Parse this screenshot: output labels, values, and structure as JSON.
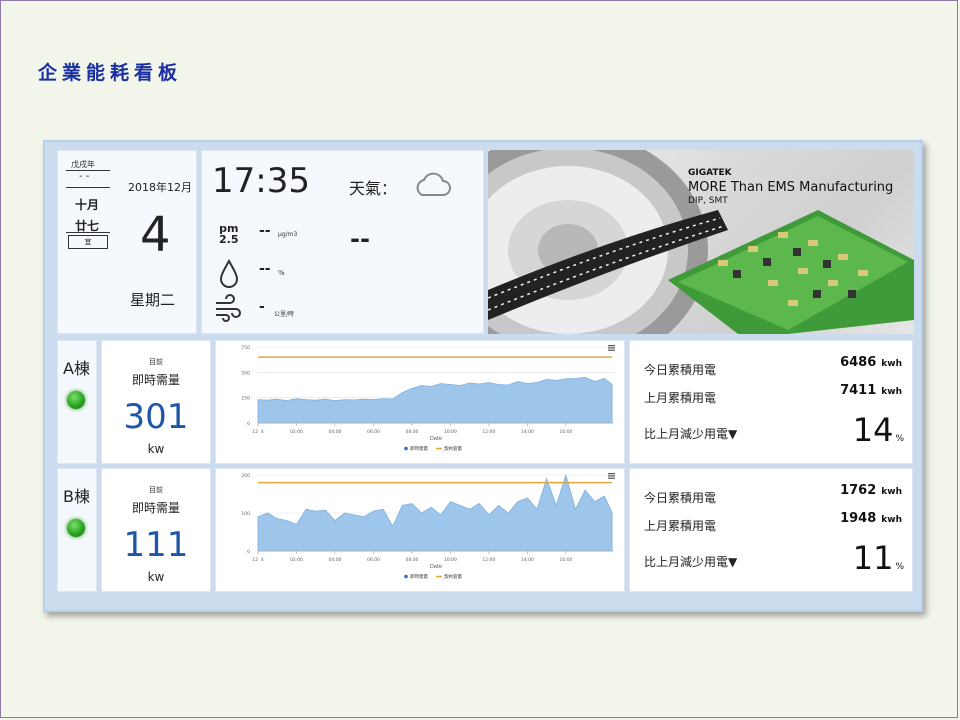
{
  "page": {
    "title": "企業能耗看板"
  },
  "calendar": {
    "ganzhi_year": "戊戌年",
    "dash": "- -",
    "lunar_month": "十月",
    "lunar_day": "廿七",
    "yi": "宜",
    "year_month": "2018年12月",
    "day": "4",
    "weekday": "星期二"
  },
  "weather": {
    "time": "17:35",
    "label": "天氣：",
    "value": "--",
    "icon": "cloud-icon",
    "pm_label_top": "pm",
    "pm_label_bottom": "2.5",
    "pm_value": "--",
    "pm_unit": "μg/m3",
    "humidity_icon": "droplet-icon",
    "humidity_value": "--",
    "humidity_unit": "%",
    "wind_icon": "wind-icon",
    "wind_value": "-",
    "wind_unit": "公里/時"
  },
  "banner": {
    "brand": "GIGATEK",
    "line1": "MORE Than EMS Manufacturing",
    "line2": "DIP, SMT"
  },
  "buildings": [
    {
      "name": "A棟",
      "status_color": "#2aa320",
      "demand_label_small": "目前",
      "demand_label": "即時需量",
      "demand_value": "301",
      "demand_unit": "kw",
      "today_label": "今日累積用電",
      "today_value": "6486",
      "lastmonth_label": "上月累積用電",
      "lastmonth_value": "7411",
      "energy_unit": "kwh",
      "compare_label": "比上月減少用電▼",
      "compare_value": "14",
      "compare_unit": "%"
    },
    {
      "name": "B棟",
      "status_color": "#2aa320",
      "demand_label_small": "目前",
      "demand_label": "即時需量",
      "demand_value": "111",
      "demand_unit": "kw",
      "today_label": "今日累積用電",
      "today_value": "1762",
      "lastmonth_label": "上月累積用電",
      "lastmonth_value": "1948",
      "energy_unit": "kwh",
      "compare_label": "比上月減少用電▼",
      "compare_value": "11",
      "compare_unit": "%"
    }
  ],
  "chart_data": [
    {
      "type": "area",
      "xlabel": "Date",
      "x_ticks": [
        "12. 4",
        "02:00",
        "04:00",
        "06:00",
        "08:00",
        "10:00",
        "12:00",
        "14:00",
        "16:00"
      ],
      "x_range": [
        0,
        18.5
      ],
      "y_ticks": [
        0,
        250,
        500,
        750
      ],
      "ylim": [
        0,
        750
      ],
      "legend": [
        "即時需量",
        "契約容量"
      ],
      "series": [
        {
          "name": "即時需量",
          "color": "#9ec5ea",
          "x": [
            0,
            0.5,
            1,
            1.5,
            2,
            2.5,
            3,
            3.5,
            4,
            4.5,
            5,
            5.5,
            6,
            6.5,
            7,
            7.5,
            8,
            8.5,
            9,
            9.5,
            10,
            10.5,
            11,
            11.5,
            12,
            12.5,
            13,
            13.5,
            14,
            14.5,
            15,
            15.5,
            16,
            16.5,
            17,
            17.5,
            18,
            18.4
          ],
          "values": [
            230,
            225,
            235,
            220,
            240,
            230,
            225,
            235,
            220,
            230,
            228,
            235,
            232,
            240,
            238,
            300,
            340,
            370,
            360,
            390,
            380,
            370,
            395,
            385,
            400,
            380,
            375,
            410,
            390,
            400,
            430,
            420,
            435,
            440,
            450,
            410,
            440,
            380
          ]
        },
        {
          "name": "契約容量",
          "color": "#e1a73d",
          "x": [
            0,
            18.4
          ],
          "values": [
            650,
            650
          ]
        }
      ]
    },
    {
      "type": "area",
      "xlabel": "Date",
      "x_ticks": [
        "12. 4",
        "02:00",
        "04:00",
        "06:00",
        "08:00",
        "10:00",
        "12:00",
        "14:00",
        "16:00"
      ],
      "x_range": [
        0,
        18.5
      ],
      "y_ticks": [
        0,
        100,
        200
      ],
      "ylim": [
        0,
        200
      ],
      "legend": [
        "即時需量",
        "契約容量"
      ],
      "series": [
        {
          "name": "即時需量",
          "color": "#9ec5ea",
          "x": [
            0,
            0.5,
            1,
            1.5,
            2,
            2.5,
            3,
            3.5,
            4,
            4.5,
            5,
            5.5,
            6,
            6.5,
            7,
            7.5,
            8,
            8.5,
            9,
            9.5,
            10,
            10.5,
            11,
            11.5,
            12,
            12.5,
            13,
            13.5,
            14,
            14.5,
            15,
            15.5,
            16,
            16.5,
            17,
            17.5,
            18,
            18.4
          ],
          "values": [
            90,
            100,
            85,
            80,
            70,
            110,
            105,
            108,
            80,
            100,
            95,
            90,
            105,
            110,
            65,
            120,
            125,
            100,
            115,
            95,
            130,
            120,
            110,
            125,
            95,
            120,
            100,
            130,
            140,
            110,
            190,
            120,
            200,
            110,
            160,
            130,
            145,
            100
          ]
        },
        {
          "name": "契約容量",
          "color": "#e1a73d",
          "x": [
            0,
            18.4
          ],
          "values": [
            180,
            180
          ]
        }
      ]
    }
  ]
}
